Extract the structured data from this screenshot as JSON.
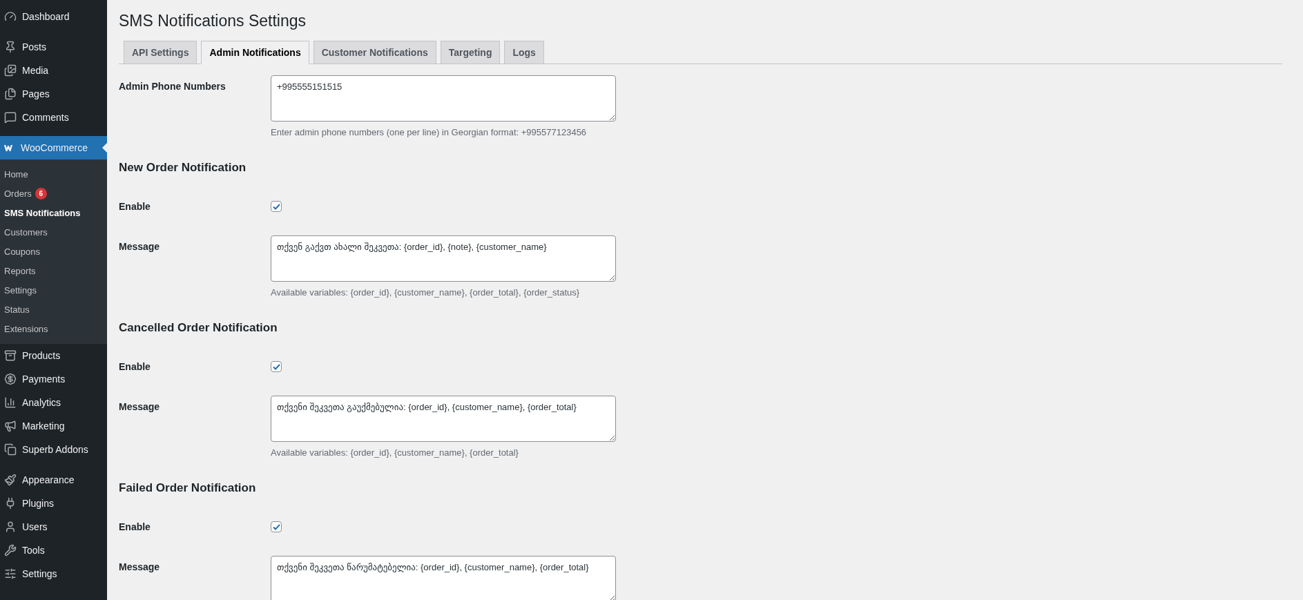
{
  "sidebar": {
    "groups": [
      {
        "items": [
          {
            "label": "Dashboard",
            "selected": false
          }
        ]
      },
      {
        "items": [
          {
            "label": "Posts",
            "selected": false
          },
          {
            "label": "Media",
            "selected": false
          },
          {
            "label": "Pages",
            "selected": false
          },
          {
            "label": "Comments",
            "selected": false
          }
        ]
      },
      {
        "items": [
          {
            "label": "WooCommerce",
            "selected": true,
            "children": [
              {
                "label": "Home",
                "selected": false
              },
              {
                "label": "Orders",
                "badge": "6",
                "selected": false
              },
              {
                "label": "SMS Notifications",
                "selected": true
              },
              {
                "label": "Customers",
                "selected": false
              },
              {
                "label": "Coupons",
                "selected": false
              },
              {
                "label": "Reports",
                "selected": false
              },
              {
                "label": "Settings",
                "selected": false
              },
              {
                "label": "Status",
                "selected": false
              },
              {
                "label": "Extensions",
                "selected": false
              }
            ]
          },
          {
            "label": "Products",
            "selected": false
          },
          {
            "label": "Payments",
            "selected": false
          },
          {
            "label": "Analytics",
            "selected": false
          },
          {
            "label": "Marketing",
            "selected": false
          },
          {
            "label": "Superb Addons",
            "selected": false
          }
        ]
      },
      {
        "items": [
          {
            "label": "Appearance",
            "selected": false
          },
          {
            "label": "Plugins",
            "selected": false
          },
          {
            "label": "Users",
            "selected": false
          },
          {
            "label": "Tools",
            "selected": false
          },
          {
            "label": "Settings",
            "selected": false
          }
        ]
      }
    ]
  },
  "page": {
    "title": "SMS Notifications Settings"
  },
  "tabs": [
    {
      "label": "API Settings",
      "selected": false
    },
    {
      "label": "Admin Notifications",
      "selected": true
    },
    {
      "label": "Customer Notifications",
      "selected": false
    },
    {
      "label": "Targeting",
      "selected": false
    },
    {
      "label": "Logs",
      "selected": false
    }
  ],
  "phone_field": {
    "label": "Admin Phone Numbers",
    "value": "+995555151515",
    "description": "Enter admin phone numbers (one per line) in Georgian format: +995577123456"
  },
  "notifications": [
    {
      "heading": "New Order Notification",
      "enable": {
        "label": "Enable",
        "checked": true
      },
      "message": {
        "label": "Message",
        "value": "თქვენ გაქვთ ახალი შეკვეთა: {order_id}, {note}, {customer_name}",
        "description": "Available variables: {order_id}, {customer_name}, {order_total}, {order_status}"
      }
    },
    {
      "heading": "Cancelled Order Notification",
      "enable": {
        "label": "Enable",
        "checked": true
      },
      "message": {
        "label": "Message",
        "value": "თქვენი შეკვეთა გაუქმებულია: {order_id}, {customer_name}, {order_total}",
        "description": "Available variables: {order_id}, {customer_name}, {order_total}"
      }
    },
    {
      "heading": "Failed Order Notification",
      "enable": {
        "label": "Enable",
        "checked": true
      },
      "message": {
        "label": "Message",
        "value": "თქვენი შეკვეთა წარუმატებელია: {order_id}, {customer_name}, {order_total}"
      }
    }
  ]
}
